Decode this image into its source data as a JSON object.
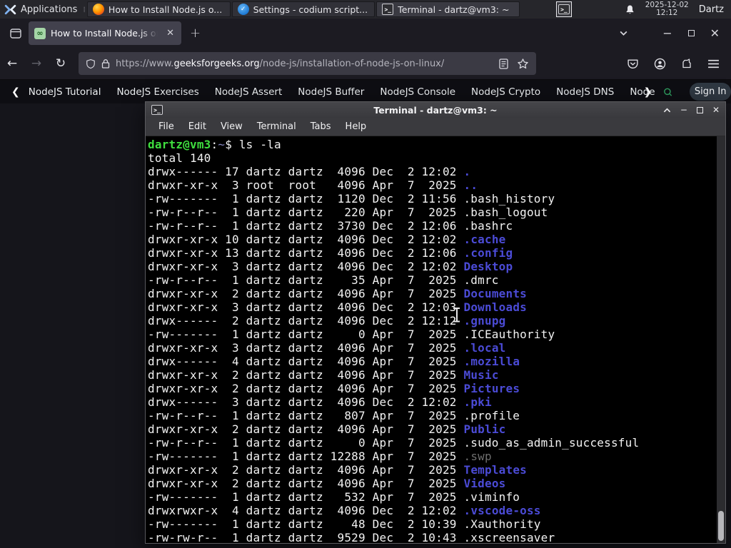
{
  "panel": {
    "applications_label": "Applications",
    "tasks": [
      {
        "icon": "firefox",
        "title": "How to Install Node.js o..."
      },
      {
        "icon": "codium",
        "title": "Settings - codium script..."
      },
      {
        "icon": "terminal",
        "title": "Terminal - dartz@vm3: ~"
      }
    ],
    "clock": {
      "date": "2025-12-02",
      "time": "12:12"
    },
    "user": "Dartz"
  },
  "browser": {
    "tab_title": "How to Install Node.js on",
    "favicon_text": "∞",
    "url": {
      "prefix": "https://www.",
      "domain": "geeksforgeeks.org",
      "path": "/node-js/installation-of-node-js-on-linux/"
    },
    "site_nav": {
      "links": [
        "NodeJS Tutorial",
        "NodeJS Exercises",
        "NodeJS Assert",
        "NodeJS Buffer",
        "NodeJS Console",
        "NodeJS Crypto",
        "NodeJS DNS",
        "Node"
      ],
      "sign_in_label": "Sign In",
      "accent_green": "#2f9e5f"
    }
  },
  "terminal": {
    "window_title": "Terminal - dartz@vm3: ~",
    "menu_items": [
      "File",
      "Edit",
      "View",
      "Terminal",
      "Tabs",
      "Help"
    ],
    "colors": {
      "background": "#000000",
      "foreground": "#f2f2f2",
      "prompt_user": "#3fdf3f",
      "prompt_path": "#8585c0",
      "directory": "#4b4bd6",
      "dim": "#6e6e6e"
    },
    "lines": [
      [
        [
          "user",
          "dartz@vm3"
        ],
        [
          "d",
          ":"
        ],
        [
          "path",
          "~"
        ],
        [
          "d",
          "$ ls -la"
        ]
      ],
      [
        [
          "d",
          "total 140"
        ]
      ],
      [
        [
          "d",
          "drwx------ 17 dartz dartz  4096 Dec  2 12:02 "
        ],
        [
          "dir",
          "."
        ]
      ],
      [
        [
          "d",
          "drwxr-xr-x  3 root  root   4096 Apr  7  2025 "
        ],
        [
          "dir",
          ".."
        ]
      ],
      [
        [
          "d",
          "-rw-------  1 dartz dartz  1120 Dec  2 11:56 .bash_history"
        ]
      ],
      [
        [
          "d",
          "-rw-r--r--  1 dartz dartz   220 Apr  7  2025 .bash_logout"
        ]
      ],
      [
        [
          "d",
          "-rw-r--r--  1 dartz dartz  3730 Dec  2 12:06 .bashrc"
        ]
      ],
      [
        [
          "d",
          "drwxr-xr-x 10 dartz dartz  4096 Dec  2 12:02 "
        ],
        [
          "dir",
          ".cache"
        ]
      ],
      [
        [
          "d",
          "drwxr-xr-x 13 dartz dartz  4096 Dec  2 12:06 "
        ],
        [
          "dir",
          ".config"
        ]
      ],
      [
        [
          "d",
          "drwxr-xr-x  3 dartz dartz  4096 Dec  2 12:02 "
        ],
        [
          "dir",
          "Desktop"
        ]
      ],
      [
        [
          "d",
          "-rw-r--r--  1 dartz dartz    35 Apr  7  2025 .dmrc"
        ]
      ],
      [
        [
          "d",
          "drwxr-xr-x  2 dartz dartz  4096 Apr  7  2025 "
        ],
        [
          "dir",
          "Documents"
        ]
      ],
      [
        [
          "d",
          "drwxr-xr-x  3 dartz dartz  4096 Dec  2 12:03 "
        ],
        [
          "dir",
          "Downloads"
        ]
      ],
      [
        [
          "d",
          "drwx------  2 dartz dartz  4096 Dec  2 12:12 "
        ],
        [
          "dir",
          ".gnupg"
        ]
      ],
      [
        [
          "d",
          "-rw-------  1 dartz dartz     0 Apr  7  2025 .ICEauthority"
        ]
      ],
      [
        [
          "d",
          "drwxr-xr-x  3 dartz dartz  4096 Apr  7  2025 "
        ],
        [
          "dir",
          ".local"
        ]
      ],
      [
        [
          "d",
          "drwx------  4 dartz dartz  4096 Apr  7  2025 "
        ],
        [
          "dir",
          ".mozilla"
        ]
      ],
      [
        [
          "d",
          "drwxr-xr-x  2 dartz dartz  4096 Apr  7  2025 "
        ],
        [
          "dir",
          "Music"
        ]
      ],
      [
        [
          "d",
          "drwxr-xr-x  2 dartz dartz  4096 Apr  7  2025 "
        ],
        [
          "dir",
          "Pictures"
        ]
      ],
      [
        [
          "d",
          "drwx------  3 dartz dartz  4096 Dec  2 12:02 "
        ],
        [
          "dir",
          ".pki"
        ]
      ],
      [
        [
          "d",
          "-rw-r--r--  1 dartz dartz   807 Apr  7  2025 .profile"
        ]
      ],
      [
        [
          "d",
          "drwxr-xr-x  2 dartz dartz  4096 Apr  7  2025 "
        ],
        [
          "dir",
          "Public"
        ]
      ],
      [
        [
          "d",
          "-rw-r--r--  1 dartz dartz     0 Apr  7  2025 .sudo_as_admin_successful"
        ]
      ],
      [
        [
          "d",
          "-rw-------  1 dartz dartz 12288 Apr  7  2025 "
        ],
        [
          "dim",
          ".swp"
        ]
      ],
      [
        [
          "d",
          "drwxr-xr-x  2 dartz dartz  4096 Apr  7  2025 "
        ],
        [
          "dir",
          "Templates"
        ]
      ],
      [
        [
          "d",
          "drwxr-xr-x  2 dartz dartz  4096 Apr  7  2025 "
        ],
        [
          "dir",
          "Videos"
        ]
      ],
      [
        [
          "d",
          "-rw-------  1 dartz dartz   532 Apr  7  2025 .viminfo"
        ]
      ],
      [
        [
          "d",
          "drwxrwxr-x  4 dartz dartz  4096 Dec  2 12:02 "
        ],
        [
          "dir",
          ".vscode-oss"
        ]
      ],
      [
        [
          "d",
          "-rw-------  1 dartz dartz    48 Dec  2 10:39 .Xauthority"
        ]
      ],
      [
        [
          "d",
          "-rw-rw-r--  1 dartz dartz  9529 Dec  2 10:43 .xscreensaver"
        ]
      ]
    ]
  }
}
